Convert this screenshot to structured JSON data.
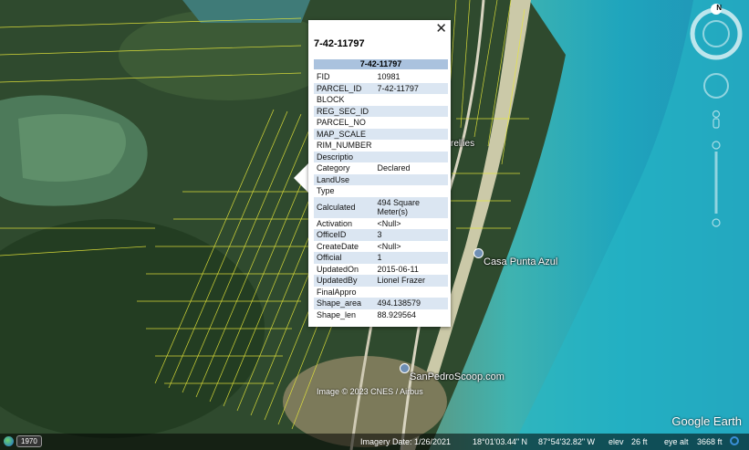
{
  "popup": {
    "title": "7-42-11797",
    "header": "7-42-11797",
    "close_label": "✕",
    "rows": [
      {
        "key": "FID",
        "value": "10981"
      },
      {
        "key": "PARCEL_ID",
        "value": "7-42-11797"
      },
      {
        "key": "BLOCK",
        "value": ""
      },
      {
        "key": "REG_SEC_ID",
        "value": ""
      },
      {
        "key": "PARCEL_NO",
        "value": ""
      },
      {
        "key": "MAP_SCALE",
        "value": ""
      },
      {
        "key": "RIM_NUMBER",
        "value": ""
      },
      {
        "key": "Descriptio",
        "value": ""
      },
      {
        "key": "Category",
        "value": "Declared"
      },
      {
        "key": "LandUse",
        "value": ""
      },
      {
        "key": "Type",
        "value": ""
      },
      {
        "key": "Calculated",
        "value": "494 Square Meter(s)"
      },
      {
        "key": "Activation",
        "value": "<Null>"
      },
      {
        "key": "OfficeID",
        "value": "3"
      },
      {
        "key": "CreateDate",
        "value": "<Null>"
      },
      {
        "key": "Official",
        "value": "1"
      },
      {
        "key": "UpdatedOn",
        "value": "2015-06-11"
      },
      {
        "key": "UpdatedBy",
        "value": "Lionel Frazer"
      },
      {
        "key": "FinalAppro",
        "value": ""
      },
      {
        "key": "Shape_area",
        "value": "494.138579"
      },
      {
        "key": "Shape_len",
        "value": "88.929564"
      }
    ]
  },
  "map_labels": {
    "casa_punta_azul": "Casa Punta Azul",
    "san_pedro_scoop": "SanPedroScoop.com",
    "ellies": "rellies"
  },
  "footer": {
    "year": "1970",
    "imagery_date": "Imagery Date: 1/26/2021",
    "lat": "18°01'03.44\" N",
    "lon": "87°54'32.82\" W",
    "elev_label": "elev",
    "elev_value": "26 ft",
    "eye_alt_label": "eye alt",
    "eye_alt_value": "3668 ft",
    "copyright": "Image © 2023 CNES / Airbus",
    "brand": "Google Earth"
  },
  "compass": {
    "north": "N"
  },
  "colors": {
    "parcel_lines": "#e8e83a",
    "popup_header": "#aac2de",
    "row_shade": "#dbe6f2"
  }
}
